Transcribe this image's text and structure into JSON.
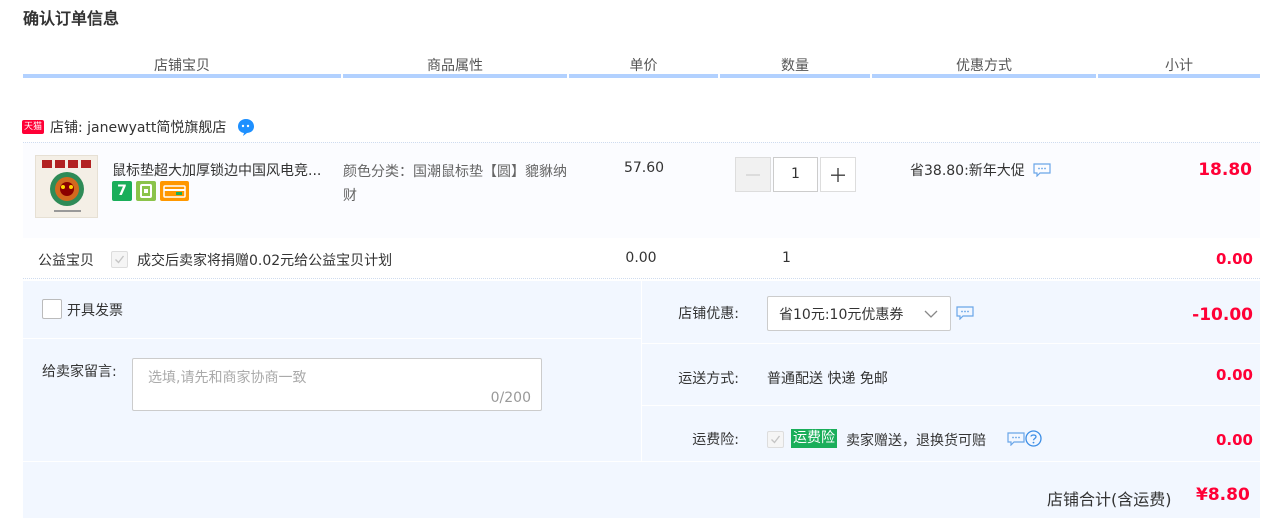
{
  "page_title": "确认订单信息",
  "columns": [
    "店铺宝贝",
    "商品属性",
    "单价",
    "数量",
    "优惠方式",
    "小计"
  ],
  "shop": {
    "badge": "天猫",
    "name": "店铺: janewyatt简悦旗舰店"
  },
  "item": {
    "title": "鼠标垫超大加厚锁边中国风电竞...",
    "attributes": "颜色分类：国潮鼠标垫【圆】貔貅纳财",
    "price": "57.60",
    "quantity": "1",
    "promo": "省38.80:新年大促",
    "subtotal": "18.80",
    "badge_seven": "7"
  },
  "charity": {
    "label": "公益宝贝",
    "text": "成交后卖家将捐赠0.02元给公益宝贝计划",
    "price": "0.00",
    "quantity": "1",
    "subtotal": "0.00"
  },
  "invoice": {
    "label": "开具发票"
  },
  "message": {
    "label": "给卖家留言:",
    "placeholder": "选填,请先和商家协商一致",
    "count": "0/200"
  },
  "shop_discount": {
    "label": "店铺优惠:",
    "selected": "省10元:10元优惠券",
    "value": "-10.00"
  },
  "shipping": {
    "label": "运送方式:",
    "method": "普通配送 快递 免邮",
    "value": "0.00"
  },
  "insurance": {
    "label": "运费险:",
    "tag": "运费险",
    "text": "卖家赠送，退换货可赔",
    "value": "0.00"
  },
  "total": {
    "label": "店铺合计(含运费)",
    "value": "¥8.80"
  },
  "colors": {
    "accent_red": "#ff0036",
    "header_bar": "#b2d1ff",
    "panel_bg": "#f2f7ff",
    "insurance_green": "#1aae5a"
  }
}
